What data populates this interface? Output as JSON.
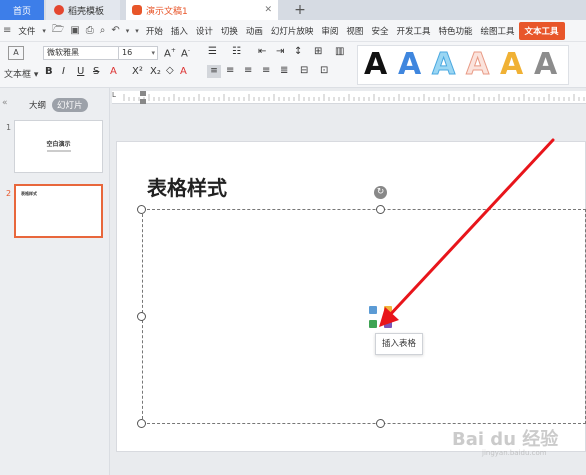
{
  "tabs": {
    "home": "首页",
    "template": "稻壳模板",
    "doc": "演示文稿1",
    "new": "+"
  },
  "menu": {
    "file": "文件",
    "items": [
      "开始",
      "插入",
      "设计",
      "切换",
      "动画",
      "幻灯片放映",
      "审阅",
      "视图",
      "安全",
      "开发工具",
      "特色功能",
      "绘图工具"
    ],
    "active": "文本工具"
  },
  "ribbon": {
    "textbox": "文本框",
    "font": "微软雅黑",
    "size": "16",
    "wordart_letter": "A"
  },
  "leftpane": {
    "outline_tab": "大纲",
    "slides_tab": "幻灯片",
    "slide1_num": "1",
    "slide1_title": "空白演示",
    "slide2_num": "2",
    "slide2_title": "表格样式"
  },
  "slide": {
    "title": "表格样式",
    "tooltip": "插入表格"
  },
  "watermark": {
    "main": "Bai du 经验",
    "sub": "jingyan.baidu.com"
  },
  "colors": {
    "accent": "#e8562a",
    "home_tab": "#3d7ee9",
    "arrow": "#e8151b"
  }
}
